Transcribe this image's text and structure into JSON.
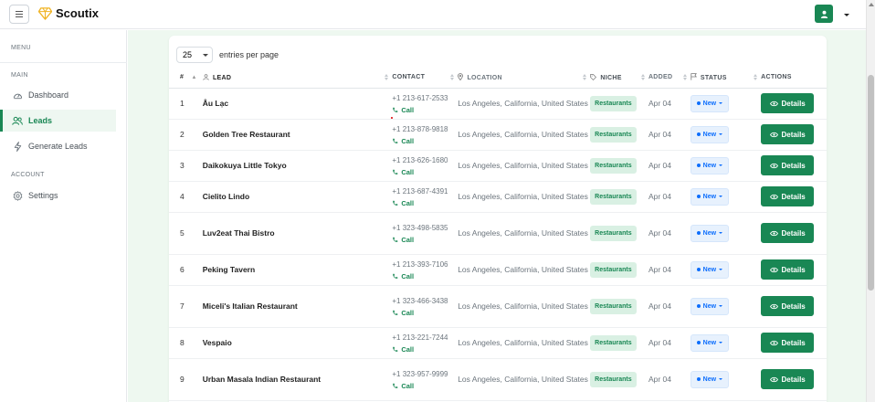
{
  "app": {
    "title": "Scoutix"
  },
  "sidebar": {
    "menu_label": "MENU",
    "main_label": "MAIN",
    "account_label": "ACCOUNT",
    "items": [
      {
        "label": "Dashboard",
        "icon": "gauge-icon",
        "active": false
      },
      {
        "label": "Leads",
        "icon": "users-icon",
        "active": true
      },
      {
        "label": "Generate Leads",
        "icon": "bolt-icon",
        "active": false
      }
    ],
    "account_items": [
      {
        "label": "Settings",
        "icon": "gear-icon",
        "active": false
      }
    ]
  },
  "toolbar": {
    "page_size": "25",
    "entries_label": "entries per page"
  },
  "table": {
    "headers": {
      "num": "#",
      "lead": "LEAD",
      "contact": "CONTACT",
      "location": "LOCATION",
      "niche": "NICHE",
      "added": "ADDED",
      "status": "STATUS",
      "actions": "ACTIONS"
    },
    "call_label": "Call",
    "details_label": "Details",
    "rows": [
      {
        "num": "1",
        "lead": "Âu Lạc",
        "phone": "+1 213-617-2533",
        "location": "Los Angeles, California, United States",
        "niche": "Restaurants",
        "added": "Apr 04",
        "status": "New"
      },
      {
        "num": "2",
        "lead": "Golden Tree Restaurant",
        "phone": "+1 213-878-9818",
        "location": "Los Angeles, California, United States",
        "niche": "Restaurants",
        "added": "Apr 04",
        "status": "New"
      },
      {
        "num": "3",
        "lead": "Daikokuya Little Tokyo",
        "phone": "+1 213-626-1680",
        "location": "Los Angeles, California, United States",
        "niche": "Restaurants",
        "added": "Apr 04",
        "status": "New"
      },
      {
        "num": "4",
        "lead": "Cielito Lindo",
        "phone": "+1 213-687-4391",
        "location": "Los Angeles, California, United States",
        "niche": "Restaurants",
        "added": "Apr 04",
        "status": "New"
      },
      {
        "num": "5",
        "lead": "Luv2eat Thai Bistro",
        "phone": "+1 323-498-5835",
        "location": "Los Angeles, California, United States",
        "niche": "Restaurants",
        "added": "Apr 04",
        "status": "New"
      },
      {
        "num": "6",
        "lead": "Peking Tavern",
        "phone": "+1 213-393-7106",
        "location": "Los Angeles, California, United States",
        "niche": "Restaurants",
        "added": "Apr 04",
        "status": "New"
      },
      {
        "num": "7",
        "lead": "Miceli's Italian Restaurant",
        "phone": "+1 323-466-3438",
        "location": "Los Angeles, California, United States",
        "niche": "Restaurants",
        "added": "Apr 04",
        "status": "New"
      },
      {
        "num": "8",
        "lead": "Vespaio",
        "phone": "+1 213-221-7244",
        "location": "Los Angeles, California, United States",
        "niche": "Restaurants",
        "added": "Apr 04",
        "status": "New"
      },
      {
        "num": "9",
        "lead": "Urban Masala Indian Restaurant",
        "phone": "+1 323-957-9999",
        "location": "Los Angeles, California, United States",
        "niche": "Restaurants",
        "added": "Apr 04",
        "status": "New"
      }
    ]
  },
  "colors": {
    "accent": "#198754",
    "status_blue": "#0d6efd",
    "page_bg": "#eef8f0"
  }
}
